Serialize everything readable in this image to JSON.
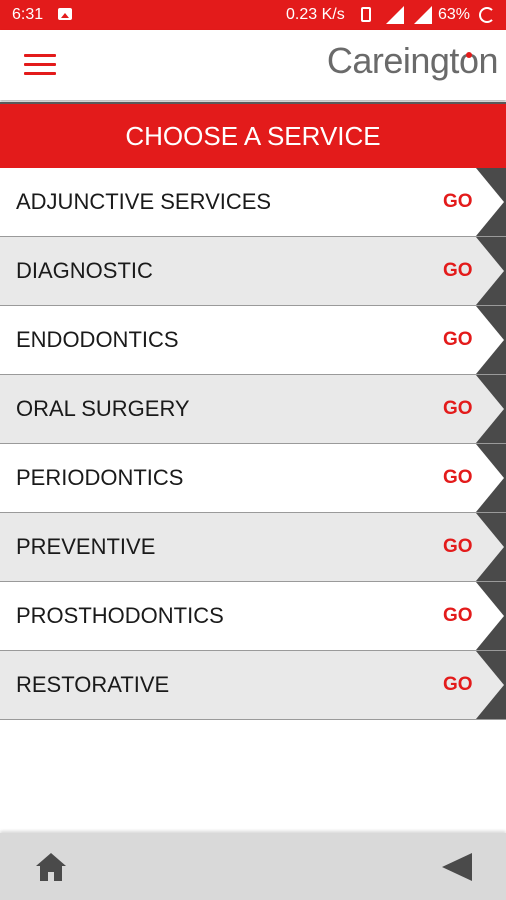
{
  "status_bar": {
    "time": "6:31",
    "speed": "0.23 K/s",
    "battery": "63%",
    "icons": [
      "image-icon",
      "vibrate-icon",
      "signal-icon",
      "signal-icon",
      "battery-icon"
    ]
  },
  "header": {
    "logo_text_start": "Careingt",
    "logo_text_o": "o",
    "logo_text_end": "n",
    "menu_icon": "hamburger-menu-icon"
  },
  "banner": {
    "title": "CHOOSE A SERVICE"
  },
  "services": [
    {
      "label": "ADJUNCTIVE SERVICES",
      "go": "GO"
    },
    {
      "label": "DIAGNOSTIC",
      "go": "GO"
    },
    {
      "label": "ENDODONTICS",
      "go": "GO"
    },
    {
      "label": "ORAL SURGERY",
      "go": "GO"
    },
    {
      "label": "PERIODONTICS",
      "go": "GO"
    },
    {
      "label": "PREVENTIVE",
      "go": "GO"
    },
    {
      "label": "PROSTHODONTICS",
      "go": "GO"
    },
    {
      "label": "RESTORATIVE",
      "go": "GO"
    }
  ],
  "bottom_nav": {
    "home_icon": "home-icon",
    "back_icon": "back-icon"
  },
  "colors": {
    "accent": "#e31b1b",
    "text": "#1a1a1a",
    "logo": "#6a6a6a",
    "row_alt": "#e9e9e9"
  }
}
